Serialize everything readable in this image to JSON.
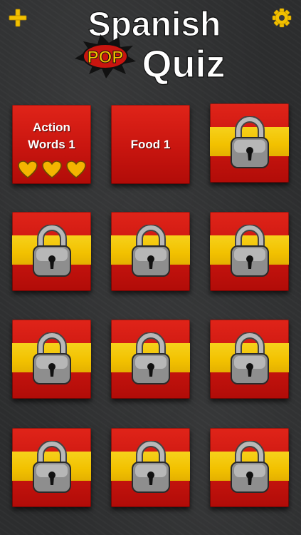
{
  "header": {
    "logo": {
      "line1": "Spanish",
      "pop": "POP",
      "line2": "Quiz"
    },
    "add_icon": "plus-icon",
    "settings_icon": "gear-icon",
    "accent_color": "#f2c100"
  },
  "levels": [
    {
      "label_line1": "Action",
      "label_line2": "Words 1",
      "hearts": 3,
      "locked": false
    },
    {
      "label_line1": "Food 1",
      "label_line2": "",
      "hearts": 0,
      "locked": false
    },
    {
      "locked": true
    },
    {
      "locked": true
    },
    {
      "locked": true
    },
    {
      "locked": true
    },
    {
      "locked": true
    },
    {
      "locked": true
    },
    {
      "locked": true
    },
    {
      "locked": true
    },
    {
      "locked": true
    },
    {
      "locked": true
    }
  ],
  "colors": {
    "flag_red": "#c8150f",
    "flag_yellow": "#f2c100",
    "heart": "#f4b400"
  }
}
